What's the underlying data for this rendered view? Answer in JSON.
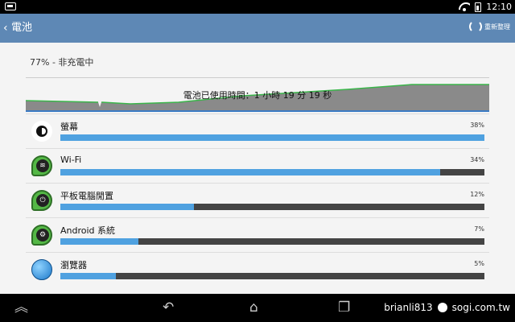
{
  "status_bar": {
    "time": "12:10"
  },
  "action_bar": {
    "title": "電池",
    "refresh_label": "重新整理"
  },
  "battery": {
    "status": "77% - 非充電中",
    "usage_time": "電池已使用時間：1 小時 19 分 19 秒",
    "graph_color": "#3ab54a"
  },
  "usage": [
    {
      "name": "螢幕",
      "percent_text": "38%",
      "percent": 38,
      "icon": "brightness-icon"
    },
    {
      "name": "Wi-Fi",
      "percent_text": "34%",
      "percent": 34,
      "icon": "wifi-icon"
    },
    {
      "name": "平板電腦閒置",
      "percent_text": "12%",
      "percent": 12,
      "icon": "power-icon"
    },
    {
      "name": "Android 系統",
      "percent_text": "7%",
      "percent": 7,
      "icon": "android-system-icon"
    },
    {
      "name": "瀏覽器",
      "percent_text": "5%",
      "percent": 5,
      "icon": "browser-icon"
    }
  ],
  "watermark": {
    "user": "brianli813",
    "site": "sogi.com.tw"
  },
  "colors": {
    "accent": "#5e88b5",
    "bar_fill": "#4fa1e0",
    "bar_track": "#444444"
  }
}
